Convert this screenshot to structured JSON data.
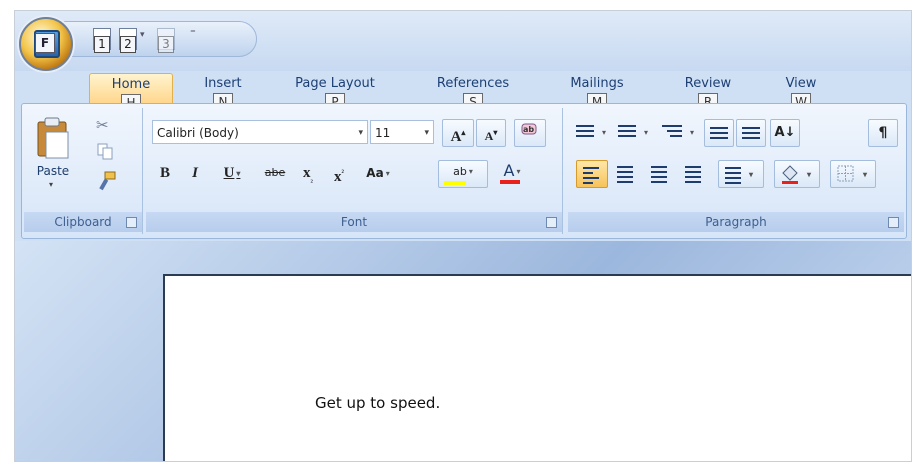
{
  "quick_access": {
    "office_button_keytip": "F",
    "items": [
      {
        "name": "save",
        "keytip": "1"
      },
      {
        "name": "undo",
        "keytip": "2"
      },
      {
        "name": "redo",
        "keytip": "3"
      }
    ]
  },
  "tabs": [
    {
      "label": "Home",
      "keytip": "H",
      "active": true
    },
    {
      "label": "Insert",
      "keytip": "N"
    },
    {
      "label": "Page Layout",
      "keytip": "P"
    },
    {
      "label": "References",
      "keytip": "S"
    },
    {
      "label": "Mailings",
      "keytip": "M"
    },
    {
      "label": "Review",
      "keytip": "R"
    },
    {
      "label": "View",
      "keytip": "W"
    }
  ],
  "ribbon": {
    "clipboard": {
      "label": "Clipboard",
      "paste_label": "Paste"
    },
    "font": {
      "label": "Font",
      "font_name": "Calibri (Body)",
      "font_size": "11",
      "grow_label": "A",
      "shrink_label": "A",
      "bold_label": "B",
      "italic_label": "I",
      "underline_label": "U",
      "strike_label": "abe",
      "subscript_label": "x",
      "superscript_label": "x",
      "change_case_label": "Aa",
      "highlight_label": "ab",
      "font_color_label": "A"
    },
    "paragraph": {
      "label": "Paragraph",
      "sort_label": "A↓",
      "show_marks_label": "¶"
    }
  },
  "document": {
    "body_text": "Get up to speed."
  },
  "colors": {
    "accent_blue": "#1c3f74",
    "active_tab": "#ffd58a",
    "highlight_yellow": "#ffff00",
    "font_color_red": "#e8221b"
  }
}
